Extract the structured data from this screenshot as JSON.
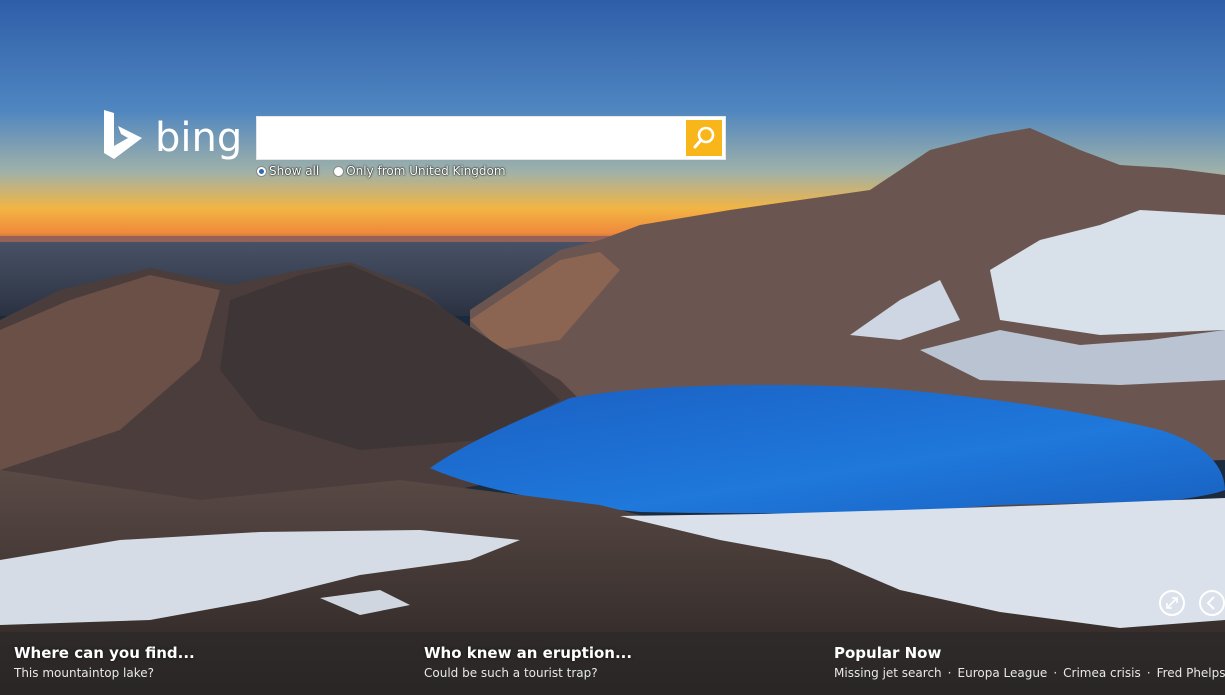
{
  "logo_text": "bing",
  "search": {
    "value": "",
    "placeholder": ""
  },
  "scope_options": [
    {
      "label": "Show all",
      "selected": true
    },
    {
      "label": "Only from United Kingdom",
      "selected": false
    }
  ],
  "controls": {
    "fullscreen_icon": "expand-icon",
    "previous_icon": "chevron-left-icon"
  },
  "hotspots": [
    {
      "title": "Where can you find...",
      "subtitle": "This mountaintop lake?"
    },
    {
      "title": "Who knew an eruption...",
      "subtitle": "Could be such a tourist trap?"
    }
  ],
  "popular_now": {
    "title": "Popular Now",
    "items": [
      "Missing jet search",
      "Europa League",
      "Crimea crisis",
      "Fred Phelps"
    ]
  },
  "colors": {
    "search_button": "#f9b61a",
    "lake": "#1f6fd0"
  }
}
